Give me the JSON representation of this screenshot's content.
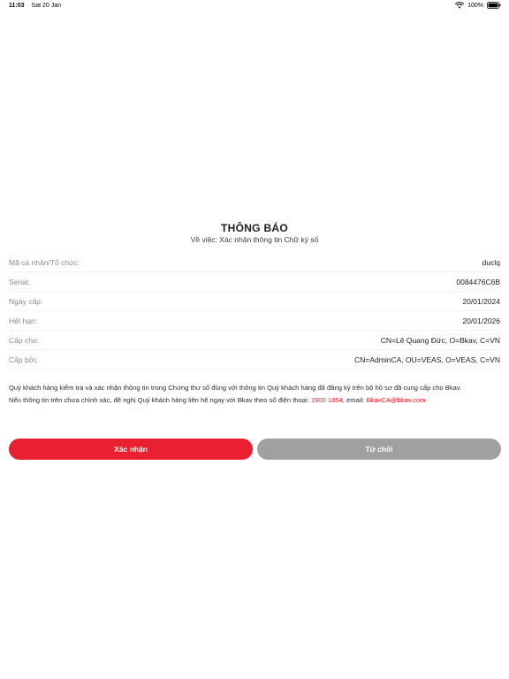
{
  "status_bar": {
    "time": "11:03",
    "date": "Sat 20 Jan",
    "battery": "100%"
  },
  "notice": {
    "title": "THÔNG BÁO",
    "subtitle": "Về việc: Xác nhận thông tin Chữ ký số",
    "rows": [
      {
        "label": "Mã cá nhân/Tổ chức:",
        "value": "duclq"
      },
      {
        "label": "Serial:",
        "value": "0084476C6B"
      },
      {
        "label": "Ngày cấp:",
        "value": "20/01/2024"
      },
      {
        "label": "Hết hạn:",
        "value": "20/01/2026"
      },
      {
        "label": "Cấp cho:",
        "value": "CN=Lê Quang Đức, O=Bkav, C=VN"
      },
      {
        "label": "Cấp bởi:",
        "value": "CN=AdminCA, OU=VEAS, O=VEAS, C=VN"
      }
    ],
    "paragraph1": "Quý khách hàng kiểm tra và xác nhận thông tin trong Chứng thư số đúng với thông tin Quý khách hàng đã đăng ký trên bộ hồ sơ đã cung cấp cho Bkav.",
    "paragraph2_prefix": "Nếu thông tin trên chưa chính xác, đề nghị Quý khách hàng liên hệ ngay với Bkav theo số điện thoại: ",
    "phone": "1900 1854",
    "email_prefix": ", email: ",
    "email": "BkavCA@bkav.com"
  },
  "buttons": {
    "confirm": "Xác nhận",
    "reject": "Từ chối"
  },
  "colors": {
    "accent": "#e8202f",
    "reject_button": "#a0a0a0"
  }
}
